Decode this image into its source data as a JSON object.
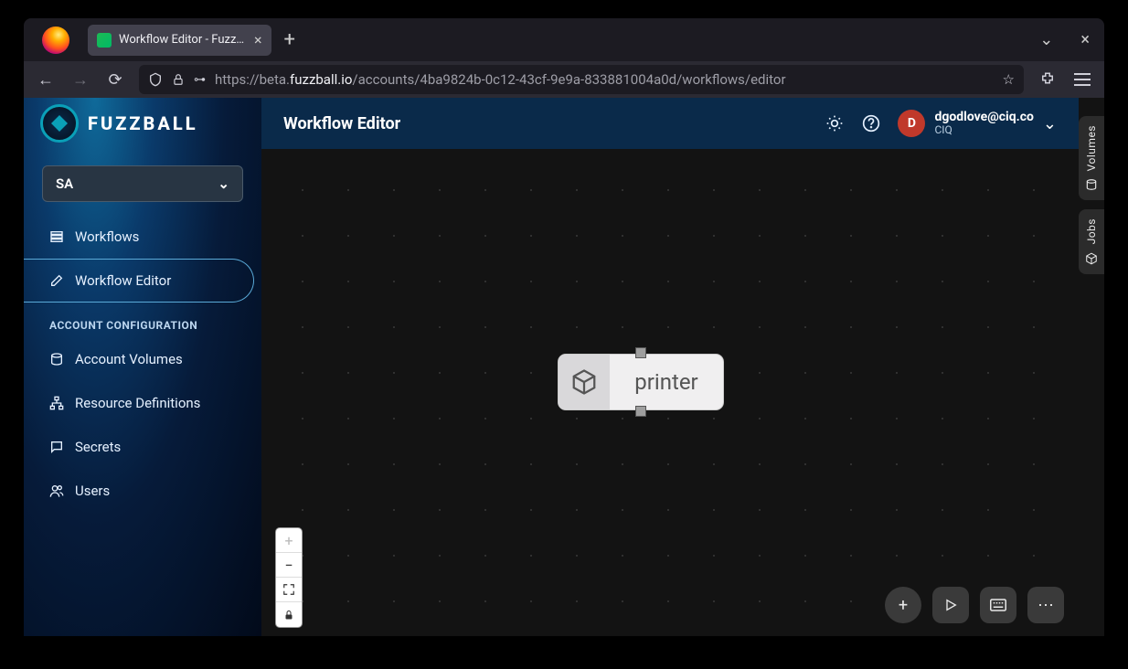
{
  "browser": {
    "tab_title": "Workflow Editor - Fuzzba",
    "url_prefix": "https://beta.",
    "url_domain": "fuzzball.io",
    "url_path": "/accounts/4ba9824b-0c12-43cf-9e9a-833881004a0d/workflows/editor"
  },
  "brand": {
    "name": "FUZZBALL"
  },
  "sidebar": {
    "account": "SA",
    "items": [
      {
        "label": "Workflows",
        "icon": "list-icon"
      },
      {
        "label": "Workflow Editor",
        "icon": "edit-icon"
      }
    ],
    "section_label": "ACCOUNT CONFIGURATION",
    "config_items": [
      {
        "label": "Account Volumes",
        "icon": "volume-icon"
      },
      {
        "label": "Resource Definitions",
        "icon": "sitemap-icon"
      },
      {
        "label": "Secrets",
        "icon": "chat-icon"
      },
      {
        "label": "Users",
        "icon": "users-icon"
      }
    ]
  },
  "header": {
    "title": "Workflow Editor",
    "user_initial": "D",
    "user_email": "dgodlove@ciq.co",
    "user_org": "CIQ"
  },
  "canvas": {
    "node_label": "printer"
  },
  "rails": {
    "volumes": "Volumes",
    "jobs": "Jobs"
  }
}
